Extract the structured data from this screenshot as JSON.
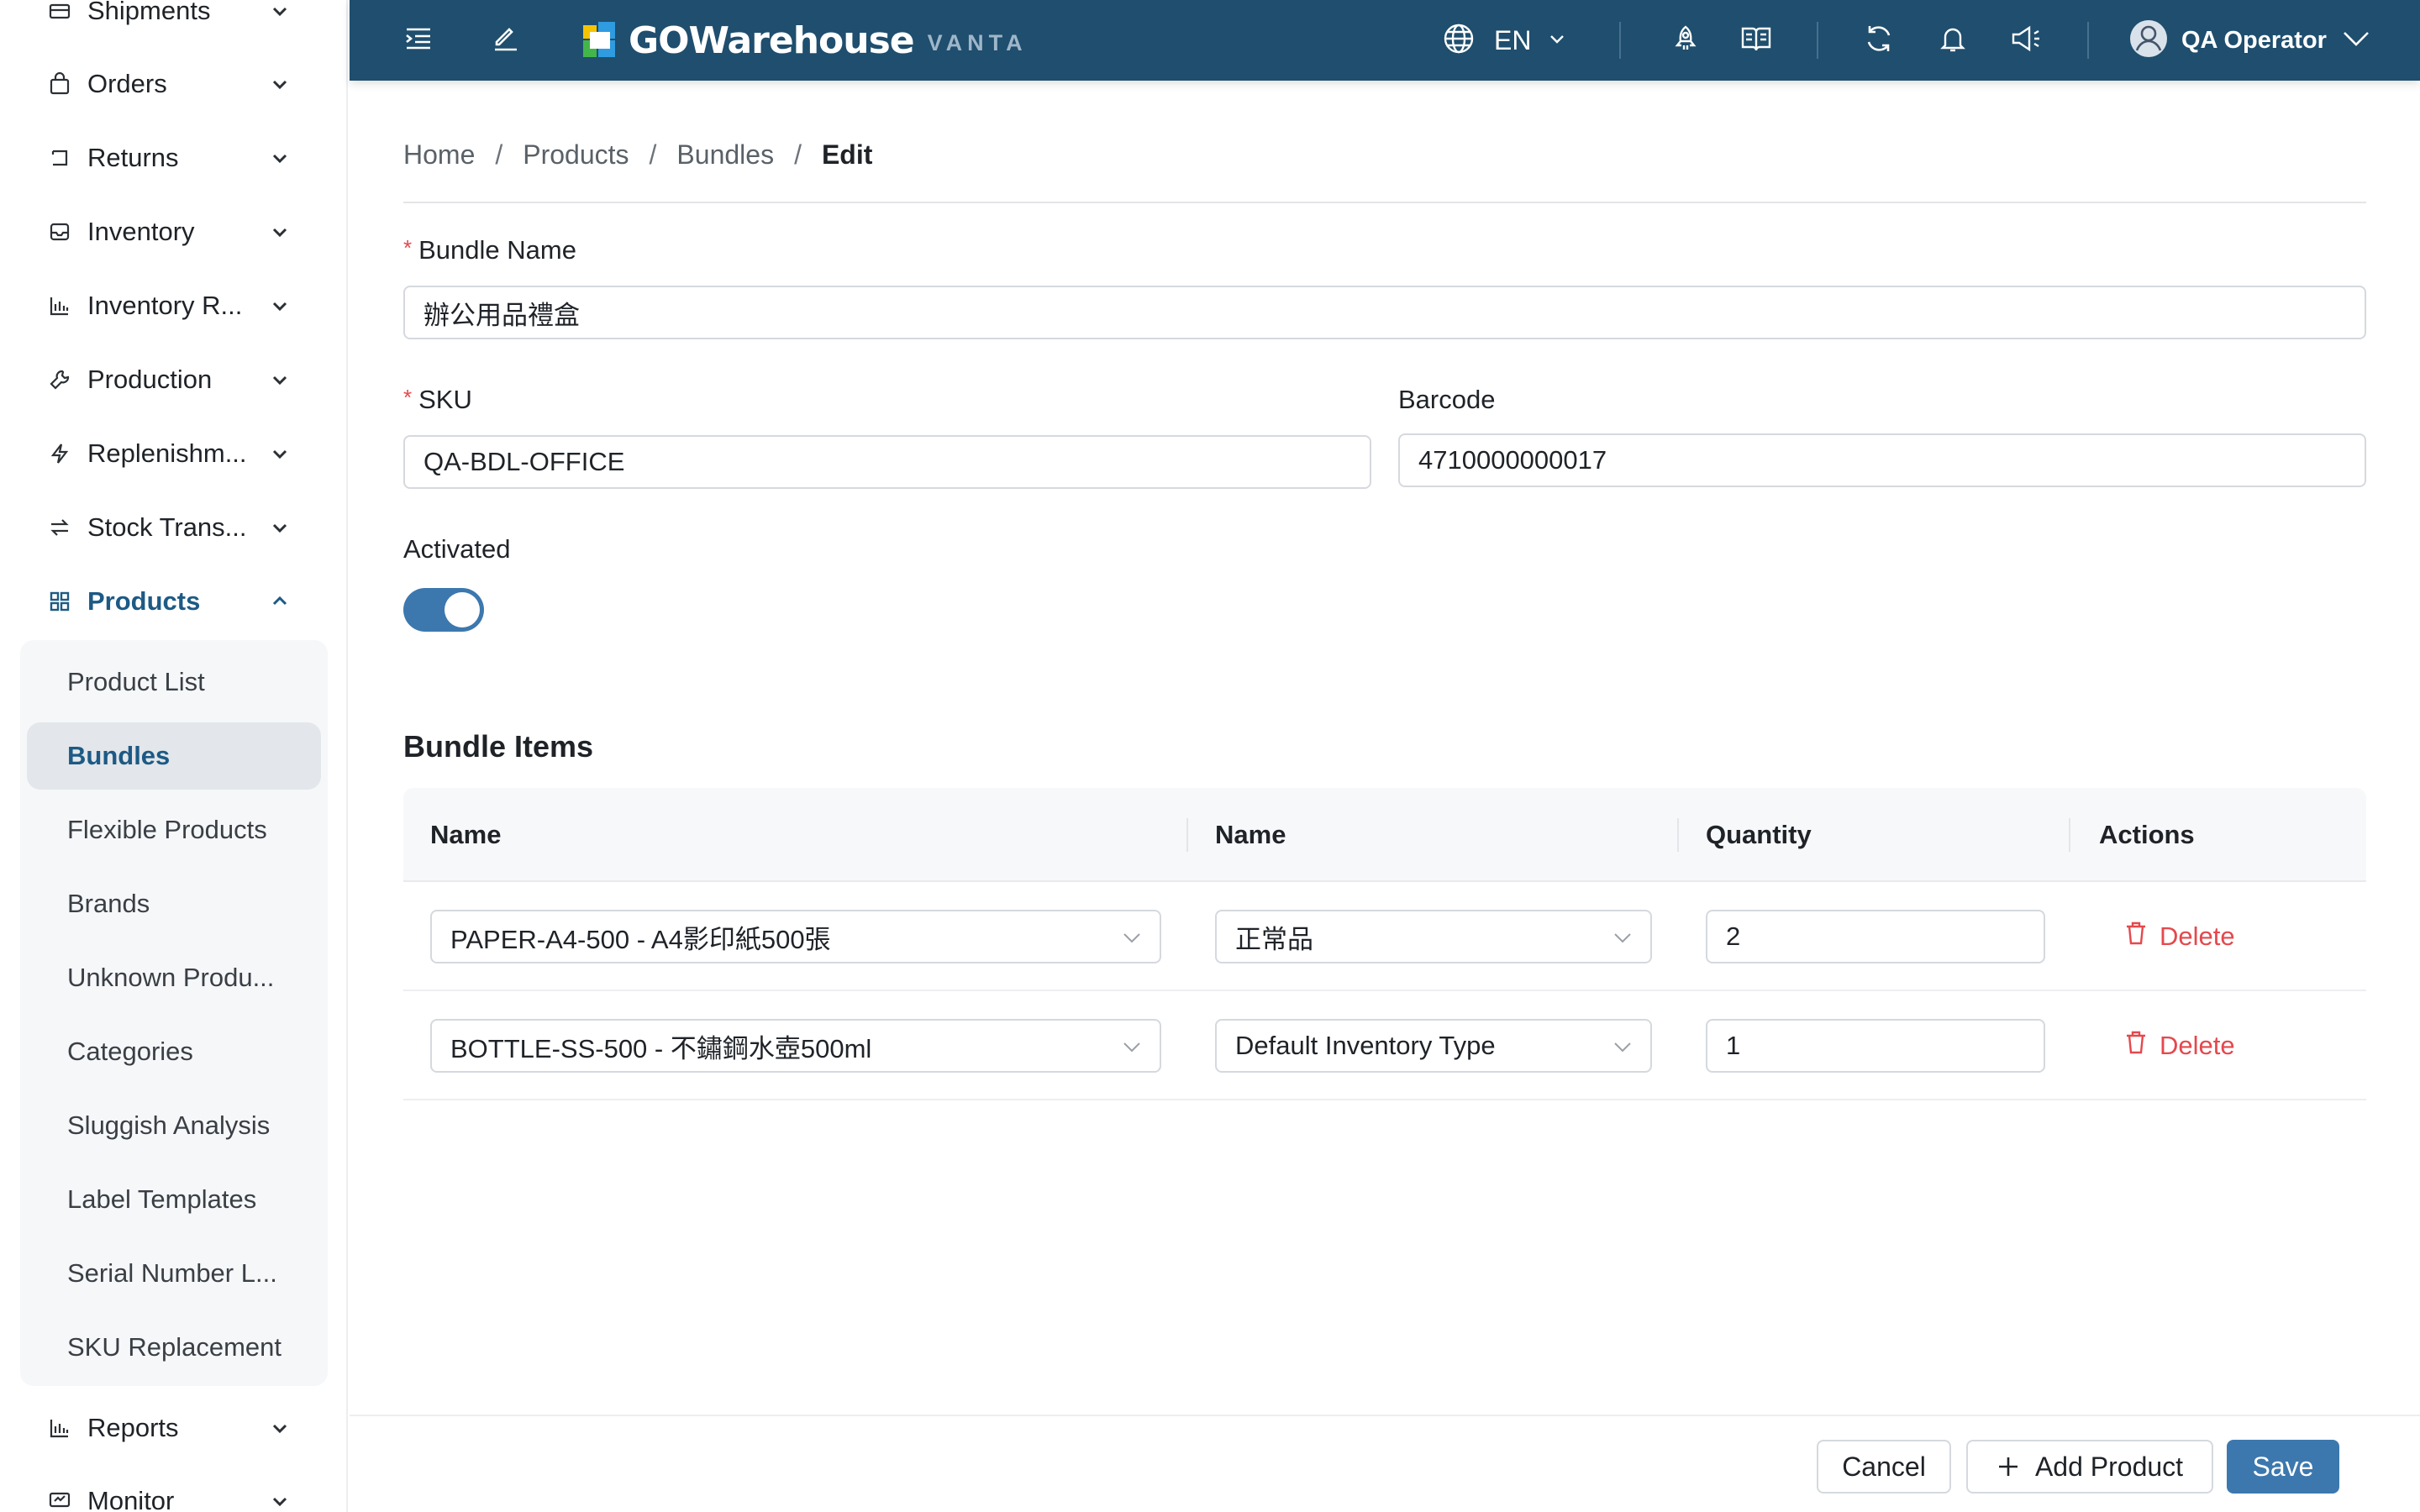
{
  "sidebar": {
    "items": [
      {
        "label": "Shipments",
        "icon": "truck-icon"
      },
      {
        "label": "Orders",
        "icon": "shopping-bag-icon"
      },
      {
        "label": "Returns",
        "icon": "return-icon"
      },
      {
        "label": "Inventory",
        "icon": "inbox-icon"
      },
      {
        "label": "Inventory R...",
        "icon": "bar-chart-icon"
      },
      {
        "label": "Production",
        "icon": "wrench-icon"
      },
      {
        "label": "Replenishm...",
        "icon": "lightning-icon"
      },
      {
        "label": "Stock Trans...",
        "icon": "transfer-icon"
      },
      {
        "label": "Products",
        "icon": "grid-icon",
        "active": true
      },
      {
        "label": "Reports",
        "icon": "bar-chart-icon"
      },
      {
        "label": "Monitor",
        "icon": "monitor-icon"
      }
    ],
    "products_submenu": [
      {
        "label": "Product List"
      },
      {
        "label": "Bundles",
        "active": true
      },
      {
        "label": "Flexible Products"
      },
      {
        "label": "Brands"
      },
      {
        "label": "Unknown Produ..."
      },
      {
        "label": "Categories"
      },
      {
        "label": "Sluggish Analysis"
      },
      {
        "label": "Label Templates"
      },
      {
        "label": "Serial Number L..."
      },
      {
        "label": "SKU Replacement"
      }
    ]
  },
  "header": {
    "logo_text": "GOWarehouse",
    "logo_sub": "VANTA",
    "language": "EN",
    "user_name": "QA Operator",
    "colors": {
      "bar": "#1f4e6e",
      "accent": "#3c78ae"
    }
  },
  "breadcrumb": [
    "Home",
    "Products",
    "Bundles",
    "Edit"
  ],
  "form": {
    "bundle_name_label": "Bundle Name",
    "bundle_name_value": "辦公用品禮盒",
    "sku_label": "SKU",
    "sku_value": "QA-BDL-OFFICE",
    "barcode_label": "Barcode",
    "barcode_value": "4710000000017",
    "activated_label": "Activated",
    "activated": true
  },
  "bundle_items": {
    "title": "Bundle Items",
    "columns": [
      "Name",
      "Name",
      "Quantity",
      "Actions"
    ],
    "rows": [
      {
        "product": "PAPER-A4-500 - A4影印紙500張",
        "inventory_type": "正常品",
        "quantity": "2",
        "action": "Delete"
      },
      {
        "product": "BOTTLE-SS-500 - 不鏽鋼水壺500ml",
        "inventory_type": "Default Inventory Type",
        "quantity": "1",
        "action": "Delete"
      }
    ]
  },
  "footer": {
    "cancel_label": "Cancel",
    "add_product_label": "Add Product",
    "save_label": "Save"
  }
}
